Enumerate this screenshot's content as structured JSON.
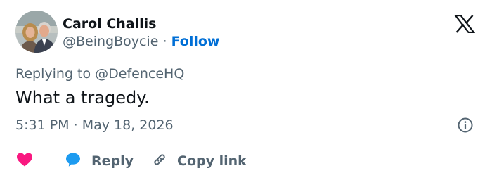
{
  "header": {
    "display_name": "Carol Challis",
    "handle": "@BeingBoycie",
    "separator": "·",
    "follow_label": "Follow",
    "logo_icon": "x-logo-icon"
  },
  "tweet": {
    "replying_prefix": "Replying to",
    "replying_handle": "@DefenceHQ",
    "text": "What a tragedy.",
    "time": "5:31 PM",
    "date_separator": "·",
    "date": "May 18, 2026"
  },
  "actions": {
    "like_icon": "heart-icon",
    "reply_label": "Reply",
    "reply_icon": "speech-bubble-icon",
    "copy_label": "Copy link",
    "copy_icon": "link-icon"
  },
  "colors": {
    "link": "#006fd6",
    "heart": "#f91880",
    "reply_bubble": "#1d9bf0",
    "secondary_text": "#536471",
    "primary_text": "#0f1419",
    "divider": "#cfd9de"
  }
}
